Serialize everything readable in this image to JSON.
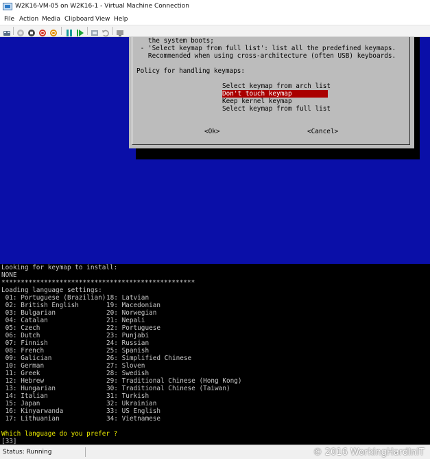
{
  "window": {
    "title": "W2K16-VM-05 on W2K16-1 - Virtual Machine Connection"
  },
  "menu": {
    "items": [
      "File",
      "Action",
      "Media",
      "Clipboard",
      "View",
      "Help"
    ]
  },
  "toolbar": {
    "icons": [
      "ctrl-alt-del-icon",
      "start-icon",
      "turn-off-icon",
      "shut-down-icon",
      "save-icon",
      "pause-icon",
      "reset-icon",
      "checkpoint-icon",
      "revert-icon",
      "enhanced-session-icon"
    ],
    "colors": {
      "power_red": "#d03020",
      "save_orange": "#e08a00",
      "play_green": "#1ea23a",
      "pause_teal": "#1a9a9a"
    }
  },
  "dialog": {
    "line1": "the system boots;",
    "line2": " - 'Select keymap from full list': list all the predefined keymaps.",
    "line3": "   Recommended when using cross-architecture (often USB) keyboards.",
    "policy_label": "Policy for handling keymaps:",
    "options": [
      "Select keymap from arch list",
      "Don't touch keymap",
      "Keep kernel keymap",
      "Select keymap from full list"
    ],
    "selected_index": 1,
    "ok_label": "<Ok>",
    "cancel_label": "<Cancel>"
  },
  "console": {
    "line_looking": "Looking for keymap to install:",
    "line_none": "NONE",
    "line_stars": "**************************************************",
    "line_loading": "Loading language settings:",
    "languages_left": [
      " 01: Portuguese (Brazilian)",
      " 02: British English",
      " 03: Bulgarian",
      " 04: Catalan",
      " 05: Czech",
      " 06: Dutch",
      " 07: Finnish",
      " 08: French",
      " 09: Galician",
      " 10: German",
      " 11: Greek",
      " 12: Hebrew",
      " 13: Hungarian",
      " 14: Italian",
      " 15: Japan",
      " 16: Kinyarwanda",
      " 17: Lithuanian"
    ],
    "languages_right": [
      "18: Latvian",
      "19: Macedonian",
      "20: Norwegian",
      "21: Nepali",
      "22: Portuguese",
      "23: Punjabi",
      "24: Russian",
      "25: Spanish",
      "26: Simplified Chinese",
      "27: Sloven",
      "28: Swedish",
      "29: Traditional Chinese (Hong Kong)",
      "30: Traditional Chinese (Taiwan)",
      "31: Turkish",
      "32: Ukrainian",
      "33: US English",
      "34: Vietnamese"
    ],
    "prompt": "Which language do you prefer ?",
    "input_value": "[33]",
    "colors": {
      "blue_bg": "#0a0fa8",
      "dialog_gray": "#bcbcbc",
      "highlight_red": "#aa0000",
      "prompt_yellow": "#e8e800"
    }
  },
  "status": {
    "text": "Status: Running"
  },
  "watermark": "© 2016 WorkingHardInIT"
}
